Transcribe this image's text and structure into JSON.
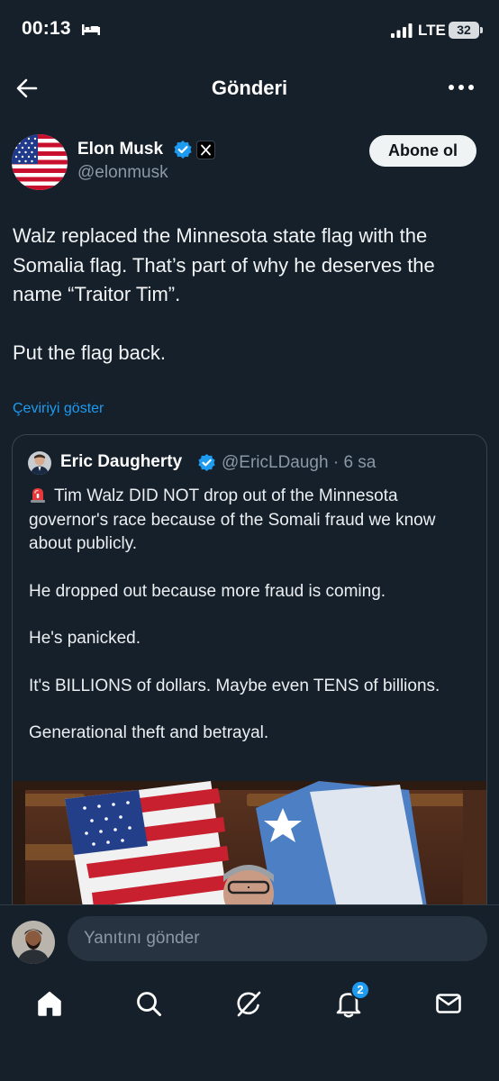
{
  "status_bar": {
    "time": "00:13",
    "network": "LTE",
    "battery": "32"
  },
  "header": {
    "title": "Gönderi"
  },
  "post": {
    "author_name": "Elon Musk",
    "author_handle": "@elonmusk",
    "follow_label": "Abone ol",
    "paragraphs": [
      "Walz replaced the Minnesota state flag with the Somalia flag. That’s part of why he deserves the name “Traitor Tim”.",
      "Put the flag back."
    ],
    "translate_label": "Çeviriyi göster"
  },
  "quote": {
    "author_name": "Eric Daugherty",
    "handle_time": "@EricLDaugh · 6 sa",
    "paragraphs": [
      "Tim Walz DID NOT drop out of the Minnesota governor's race because of the Somali fraud we know about publicly.",
      "He dropped out because more fraud is coming.",
      "He's panicked.",
      "It's BILLIONS of dollars. Maybe even TENS of billions.",
      "Generational theft and betrayal."
    ]
  },
  "reply": {
    "placeholder": "Yanıtını gönder"
  },
  "tab_bar": {
    "notification_count": "2",
    "icons": [
      "home-icon",
      "search-icon",
      "grok-icon",
      "notifications-icon",
      "messages-icon"
    ]
  },
  "colors": {
    "background": "#15202b",
    "accent": "#1d9bf0",
    "secondary_text": "#8b98a5",
    "follow_button": "#eff3f4"
  }
}
